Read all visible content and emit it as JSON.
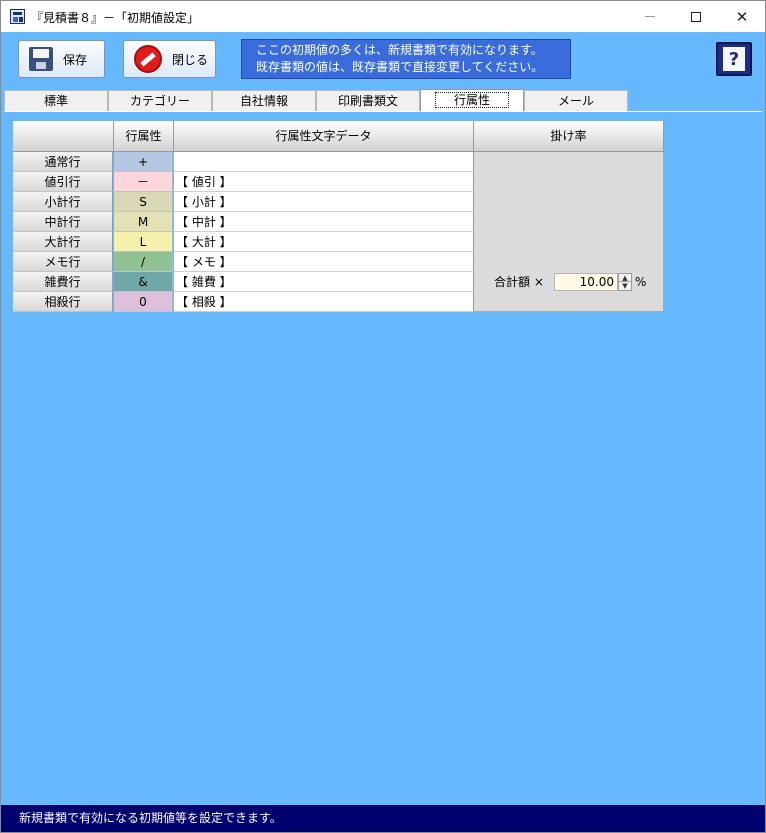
{
  "window": {
    "title": "『見積書８』－「初期値設定」"
  },
  "toolbar": {
    "save_label": "保存",
    "close_label": "閉じる",
    "notice_line1": "ここの初期値の多くは、新規書類で有効になります。",
    "notice_line2": "既存書類の値は、既存書類で直接変更してください。",
    "help_label": "?"
  },
  "tabs": [
    {
      "label": "標準"
    },
    {
      "label": "カテゴリー"
    },
    {
      "label": "自社情報"
    },
    {
      "label": "印刷書類文"
    },
    {
      "label": "行属性"
    },
    {
      "label": "メール"
    }
  ],
  "active_tab": "行属性",
  "grid": {
    "headers": {
      "attr": "行属性",
      "text": "行属性文字データ",
      "rate": "掛け率"
    },
    "rows": [
      {
        "label": "通常行",
        "attr": "+",
        "text": "",
        "color": "#b4c8e4"
      },
      {
        "label": "値引行",
        "attr": "－",
        "text": "【 値引 】",
        "color": "#fcd6da"
      },
      {
        "label": "小計行",
        "attr": "S",
        "text": "【 小計 】",
        "color": "#d8d8b4"
      },
      {
        "label": "中計行",
        "attr": "M",
        "text": "【 中計 】",
        "color": "#e2e2b4"
      },
      {
        "label": "大計行",
        "attr": "L",
        "text": "【 大計 】",
        "color": "#f6f2ae"
      },
      {
        "label": "メモ行",
        "attr": "/",
        "text": "【 メモ 】",
        "color": "#8fc292"
      },
      {
        "label": "雑費行",
        "attr": "&",
        "text": "【 雑費 】",
        "color": "#6fa8a8"
      },
      {
        "label": "相殺行",
        "attr": "0",
        "text": "【 相殺 】",
        "color": "#dcc0dc"
      }
    ],
    "rate": {
      "label": "合計額 ×",
      "value": "10.00",
      "unit": "%"
    }
  },
  "status_bar": {
    "text": "新規書類で有効になる初期値等を設定できます。"
  },
  "icons": {
    "save": "floppy-disk-icon",
    "close": "no-entry-icon",
    "help": "help-book-icon",
    "app": "app-icon"
  }
}
